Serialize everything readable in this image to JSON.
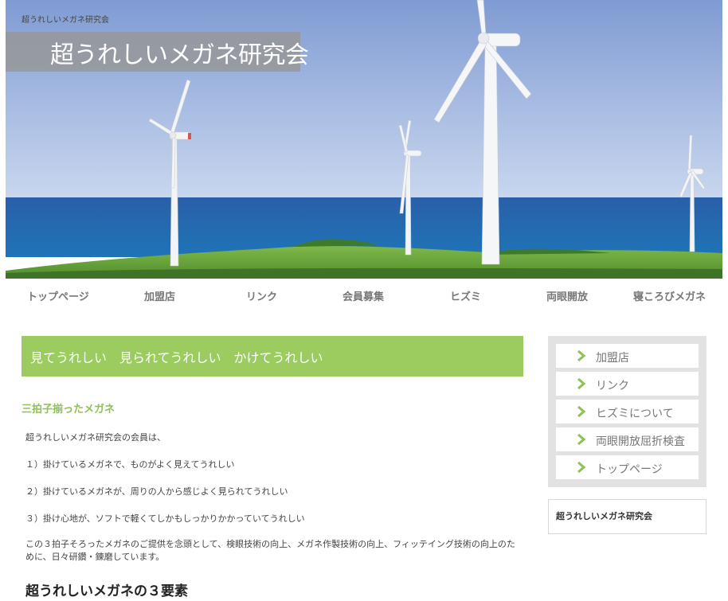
{
  "header": {
    "tagline": "超うれしいメガネ研究会",
    "site_title": "超うれしいメガネ研究会"
  },
  "nav": {
    "items": [
      {
        "label": "トップページ"
      },
      {
        "label": "加盟店"
      },
      {
        "label": "リンク"
      },
      {
        "label": "会員募集"
      },
      {
        "label": "ヒズミ"
      },
      {
        "label": "両眼開放"
      },
      {
        "label": "寝ころびメガネ"
      }
    ]
  },
  "main": {
    "catch_copy": "見てうれしい　見られてうれしい　かけてうれしい",
    "section_heading": "三拍子揃ったメガネ",
    "intro": "超うれしいメガネ研究会の会員は、",
    "points": [
      "１）掛けているメガネで、ものがよく見えてうれしい",
      "２）掛けているメガネが、周りの人から感じよく見られてうれしい",
      "３）掛け心地が、ソフトで軽くてしかもしっかりかかっていてうれしい"
    ],
    "body": "この３拍子そろったメガネのご提供を念頭として、検眼技術の向上、メガネ作製技術の向上、フィッテイング技術の向上のために、日々研鑽・錬磨しています。",
    "heading_2": "超うれしいメガネの３要素"
  },
  "sidebar": {
    "menu": [
      {
        "label": "加盟店"
      },
      {
        "label": "リンク"
      },
      {
        "label": "ヒズミについて"
      },
      {
        "label": "両眼開放屈折検査"
      },
      {
        "label": "トップページ"
      }
    ],
    "box_title": "超うれしいメガネ研究会"
  },
  "colors": {
    "accent_green": "#9ccc5f",
    "heading_green": "#8dc155",
    "nav_text": "#777777",
    "sidebar_bg": "#e2e2e2"
  },
  "icons": {
    "side_menu_bullet": "chevron-right-icon"
  }
}
